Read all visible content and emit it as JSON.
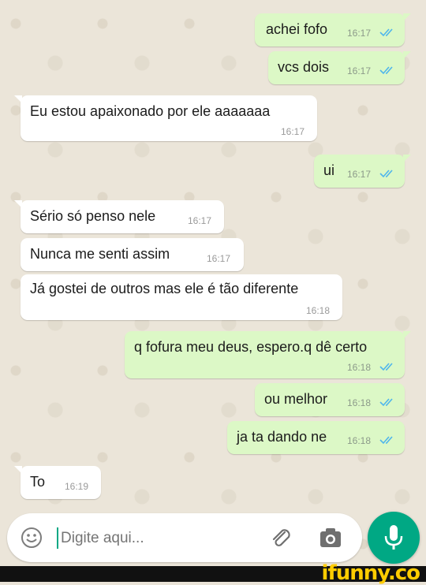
{
  "messages": [
    {
      "dir": "out",
      "text": "achei fofo",
      "time": "16:17",
      "status": "read"
    },
    {
      "dir": "out",
      "text": "vcs dois",
      "time": "16:17",
      "status": "read"
    },
    {
      "dir": "in",
      "text": "Eu estou apaixonado por ele aaaaaaa",
      "time": "16:17"
    },
    {
      "dir": "out",
      "text": "ui",
      "time": "16:17",
      "status": "read"
    },
    {
      "dir": "in",
      "text": "Sério só penso nele",
      "time": "16:17"
    },
    {
      "dir": "in",
      "text": "Nunca me senti assim",
      "time": "16:17"
    },
    {
      "dir": "in",
      "text": "Já gostei de outros mas ele é tão diferente",
      "time": "16:18"
    },
    {
      "dir": "out",
      "text": "q fofura meu deus, espero.q dê certo",
      "time": "16:18",
      "status": "read"
    },
    {
      "dir": "out",
      "text": "ou melhor",
      "time": "16:18",
      "status": "read"
    },
    {
      "dir": "out",
      "text": "ja ta dando ne",
      "time": "16:18",
      "status": "read"
    },
    {
      "dir": "in",
      "text": "To",
      "time": "16:19"
    }
  ],
  "composer": {
    "placeholder": "Digite aqui...",
    "emoji_icon": "emoji-icon",
    "attach_icon": "paperclip-icon",
    "camera_icon": "camera-icon",
    "mic_icon": "microphone-icon"
  },
  "watermark": {
    "text": "ifunny.co"
  },
  "colors": {
    "outgoing": "#dcf8c6",
    "incoming": "#ffffff",
    "accent": "#00a884",
    "read_ticks": "#4fb6ec"
  }
}
